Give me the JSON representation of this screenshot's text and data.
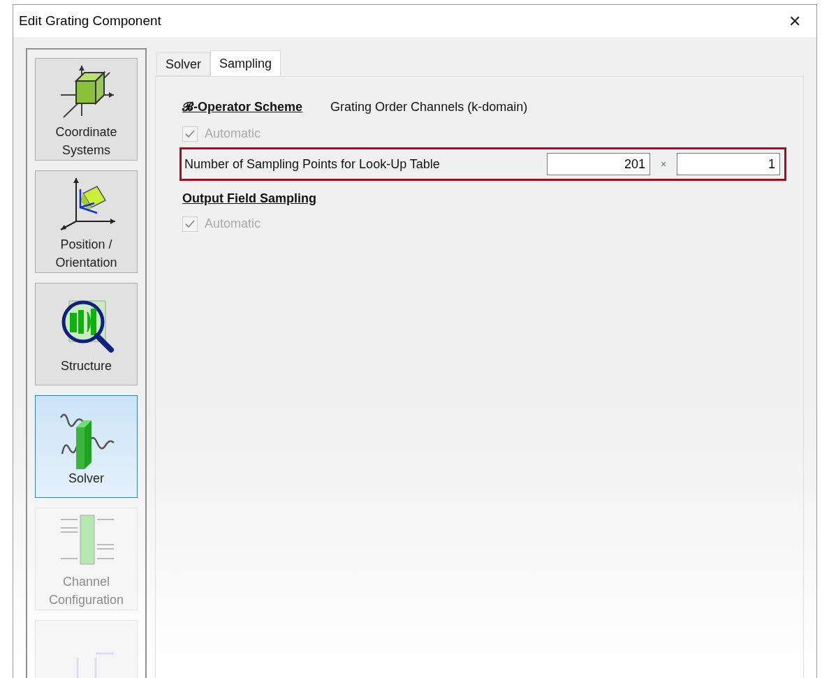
{
  "window": {
    "title": "Edit Grating Component",
    "close": "✕"
  },
  "sidebar": {
    "items": [
      {
        "kind": "coordinates",
        "label": "Coordinate Systems",
        "selected": false,
        "disabled": false
      },
      {
        "kind": "position",
        "label": "Position / Orientation",
        "selected": false,
        "disabled": false
      },
      {
        "kind": "structure",
        "label": "Structure",
        "selected": false,
        "disabled": false
      },
      {
        "kind": "solver",
        "label": "Solver",
        "selected": true,
        "disabled": false
      },
      {
        "kind": "channels",
        "label": "Channel Configuration",
        "selected": false,
        "disabled": true
      },
      {
        "kind": "transform",
        "selected": false,
        "disabled": true
      }
    ]
  },
  "tabs": [
    {
      "label": "Solver",
      "selected": false
    },
    {
      "label": "Sampling",
      "selected": true
    }
  ],
  "operator_scheme": {
    "heading": "𝓑-Operator Scheme",
    "value": "Grating Order Channels (k-domain)",
    "automatic": {
      "label": "Automatic",
      "checked": true,
      "disabled": true
    }
  },
  "lookup_table": {
    "label": "Number of Sampling Points for Look-Up Table",
    "x_value": "201",
    "separator": "×",
    "y_value": "1",
    "highlighted": true
  },
  "output_field_sampling": {
    "heading": "Output Field Sampling",
    "automatic": {
      "label": "Automatic",
      "checked": true,
      "disabled": true
    }
  }
}
